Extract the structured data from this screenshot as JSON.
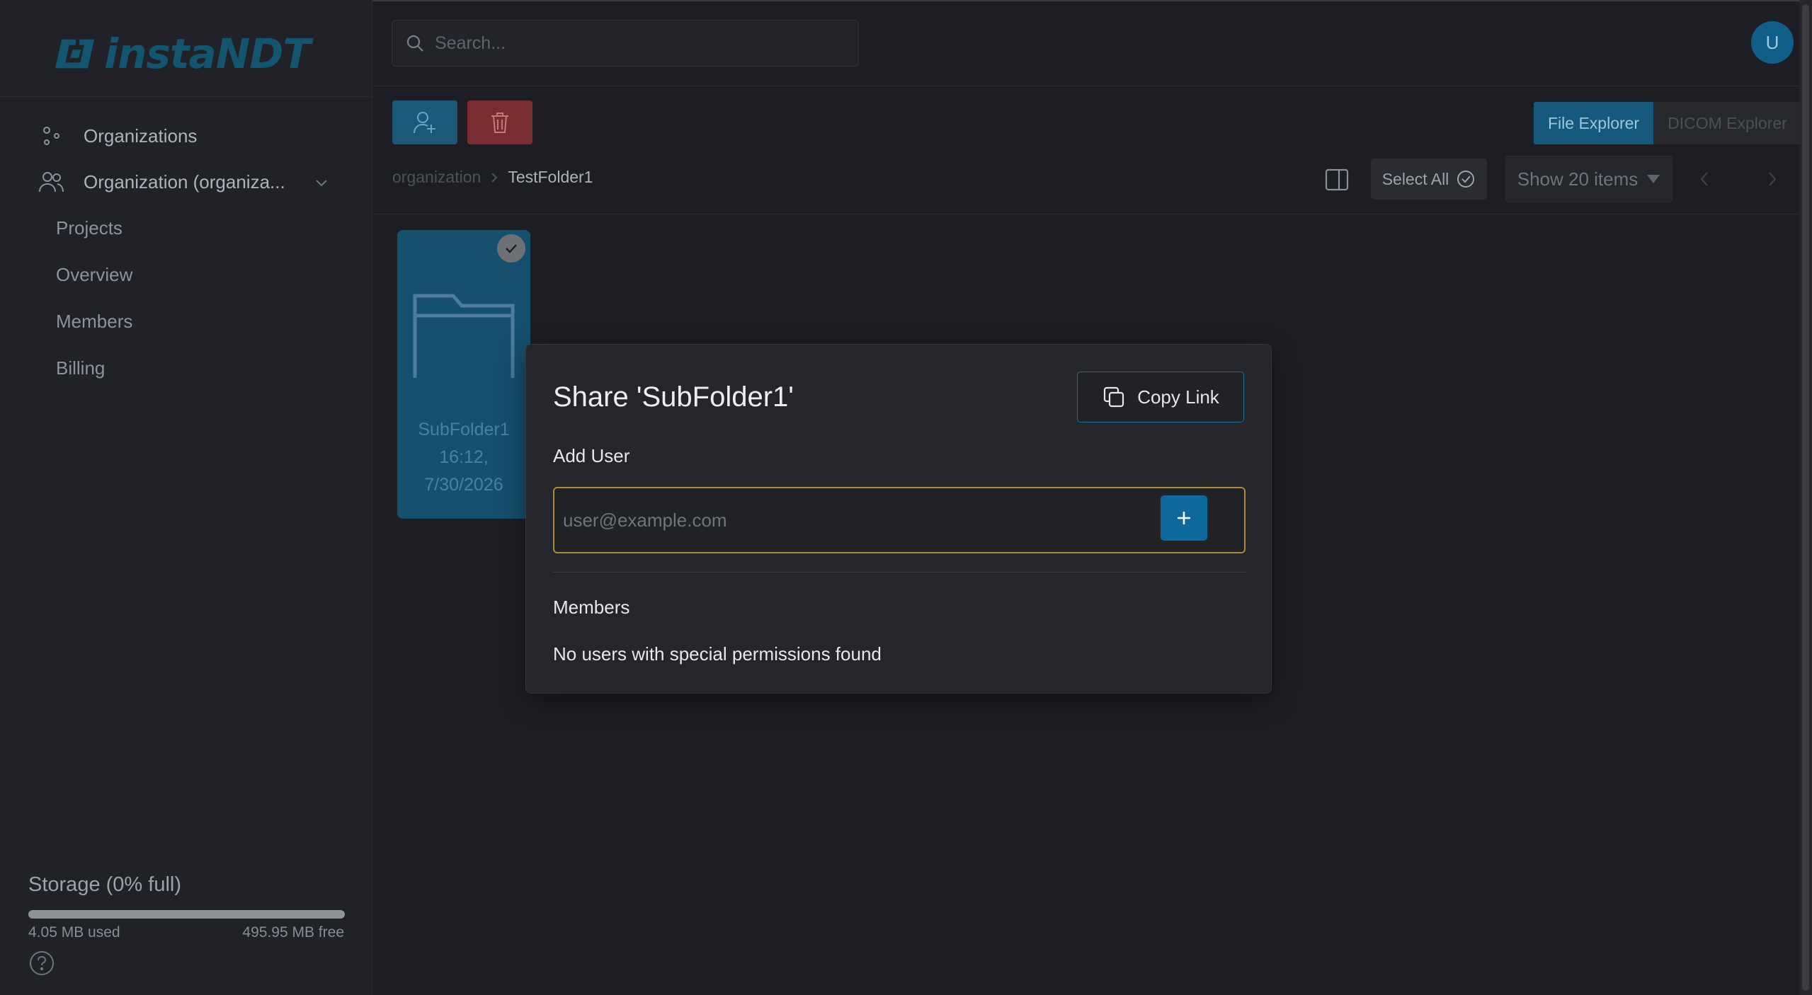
{
  "app": {
    "logo_text": "instaNDT"
  },
  "sidebar": {
    "items": [
      {
        "label": "Organizations",
        "icon": "organizations-icon"
      },
      {
        "label": "Organization (organiza...",
        "icon": "users-icon"
      }
    ],
    "sub_items": [
      {
        "label": "Projects"
      },
      {
        "label": "Overview"
      },
      {
        "label": "Members"
      },
      {
        "label": "Billing"
      }
    ],
    "storage": {
      "title": "Storage (0% full)",
      "used": "4.05 MB used",
      "free": "495.95 MB free",
      "fill_percent": 0
    }
  },
  "header": {
    "search_placeholder": "Search...",
    "avatar_initial": "U"
  },
  "toolbar": {
    "tabs": [
      {
        "label": "File Explorer",
        "active": true
      },
      {
        "label": "DICOM Explorer",
        "active": false
      }
    ],
    "breadcrumb": [
      "organization",
      "TestFolder1"
    ],
    "select_all_label": "Select All",
    "show_items_label": "Show 20 items"
  },
  "files": [
    {
      "name": "SubFolder1",
      "time": "16:12,",
      "date": "7/30/2026",
      "selected": true
    }
  ],
  "modal": {
    "title": "Share 'SubFolder1'",
    "copy_link_label": "Copy Link",
    "add_user_label": "Add User",
    "email_placeholder": "user@example.com",
    "members_label": "Members",
    "empty_members_text": "No users with special permissions found"
  },
  "colors": {
    "accent": "#0e6a9c",
    "danger": "#7a2d31",
    "focus_border": "#a88b3e",
    "background": "#1d1e23"
  }
}
